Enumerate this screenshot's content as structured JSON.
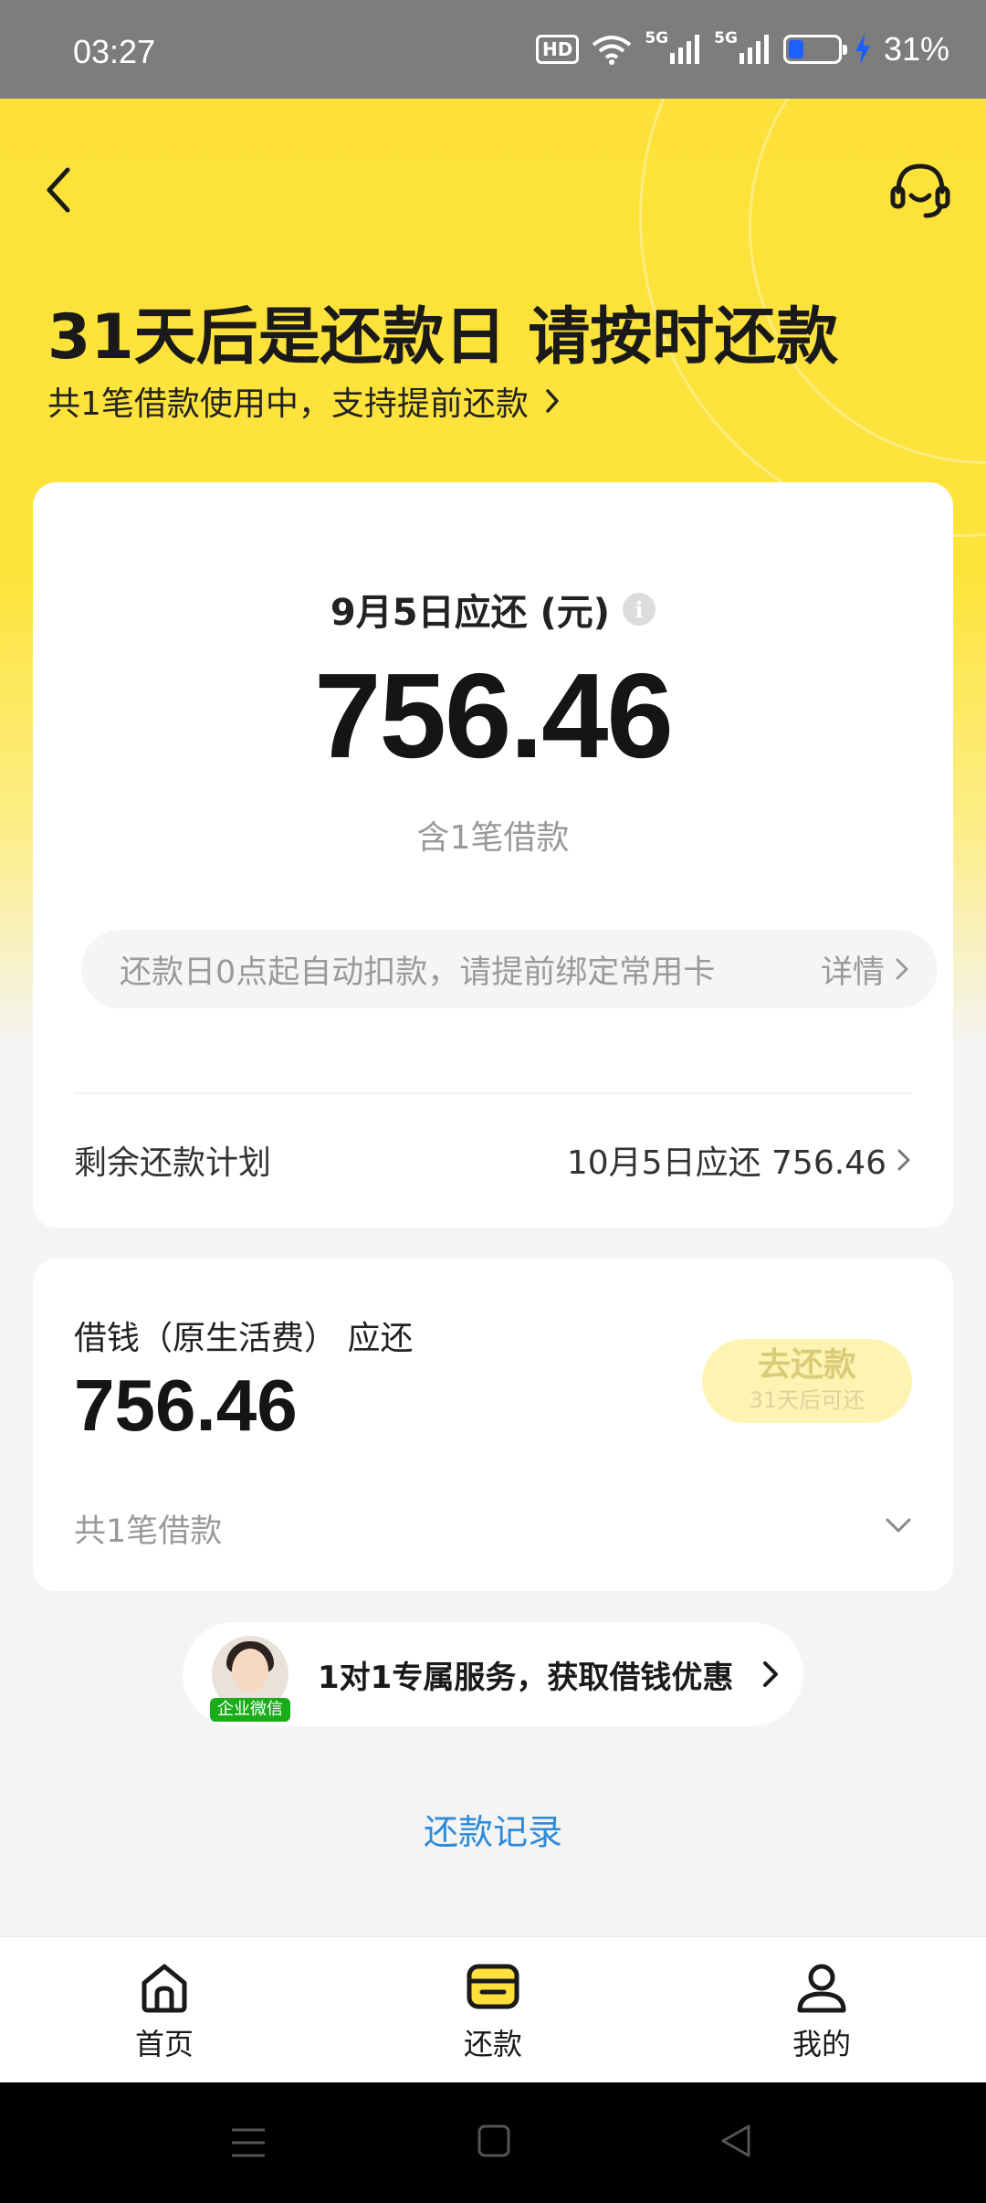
{
  "status_bar": {
    "time": "03:27",
    "hd_label": "HD",
    "net1": "5G",
    "net2": "5G",
    "battery_percent": "31%",
    "battery_level": 0.31
  },
  "header": {
    "back_icon": "chevron-left-icon",
    "service_icon": "headset-icon"
  },
  "hero": {
    "headline": "31天后是还款日 请按时还款",
    "subline": "共1笔借款使用中，支持提前还款"
  },
  "summary_card": {
    "due_label": "9月5日应还 (元)",
    "info_icon": "i",
    "due_amount": "756.46",
    "loan_count": "含1笔借款",
    "auto_deduct_text": "还款日0点起自动扣款，请提前绑定常用卡",
    "detail_label": "详情",
    "plan_label": "剩余还款计划",
    "plan_value": "10月5日应还 756.46"
  },
  "loan_card": {
    "title": "借钱（原生活费） 应还",
    "amount": "756.46",
    "repay_button": "去还款",
    "repay_hint": "31天后可还",
    "count": "共1笔借款"
  },
  "service": {
    "badge": "企业微信",
    "text": "1对1专属服务，获取借钱优惠"
  },
  "records_link": "还款记录",
  "tabs": [
    {
      "label": "首页",
      "icon": "home-icon"
    },
    {
      "label": "还款",
      "icon": "wallet-icon",
      "active": true
    },
    {
      "label": "我的",
      "icon": "user-icon"
    }
  ],
  "colors": {
    "brand_yellow": "#fde13a",
    "link_blue": "#2f8bd8",
    "disabled_button": "#fdf4b3"
  }
}
